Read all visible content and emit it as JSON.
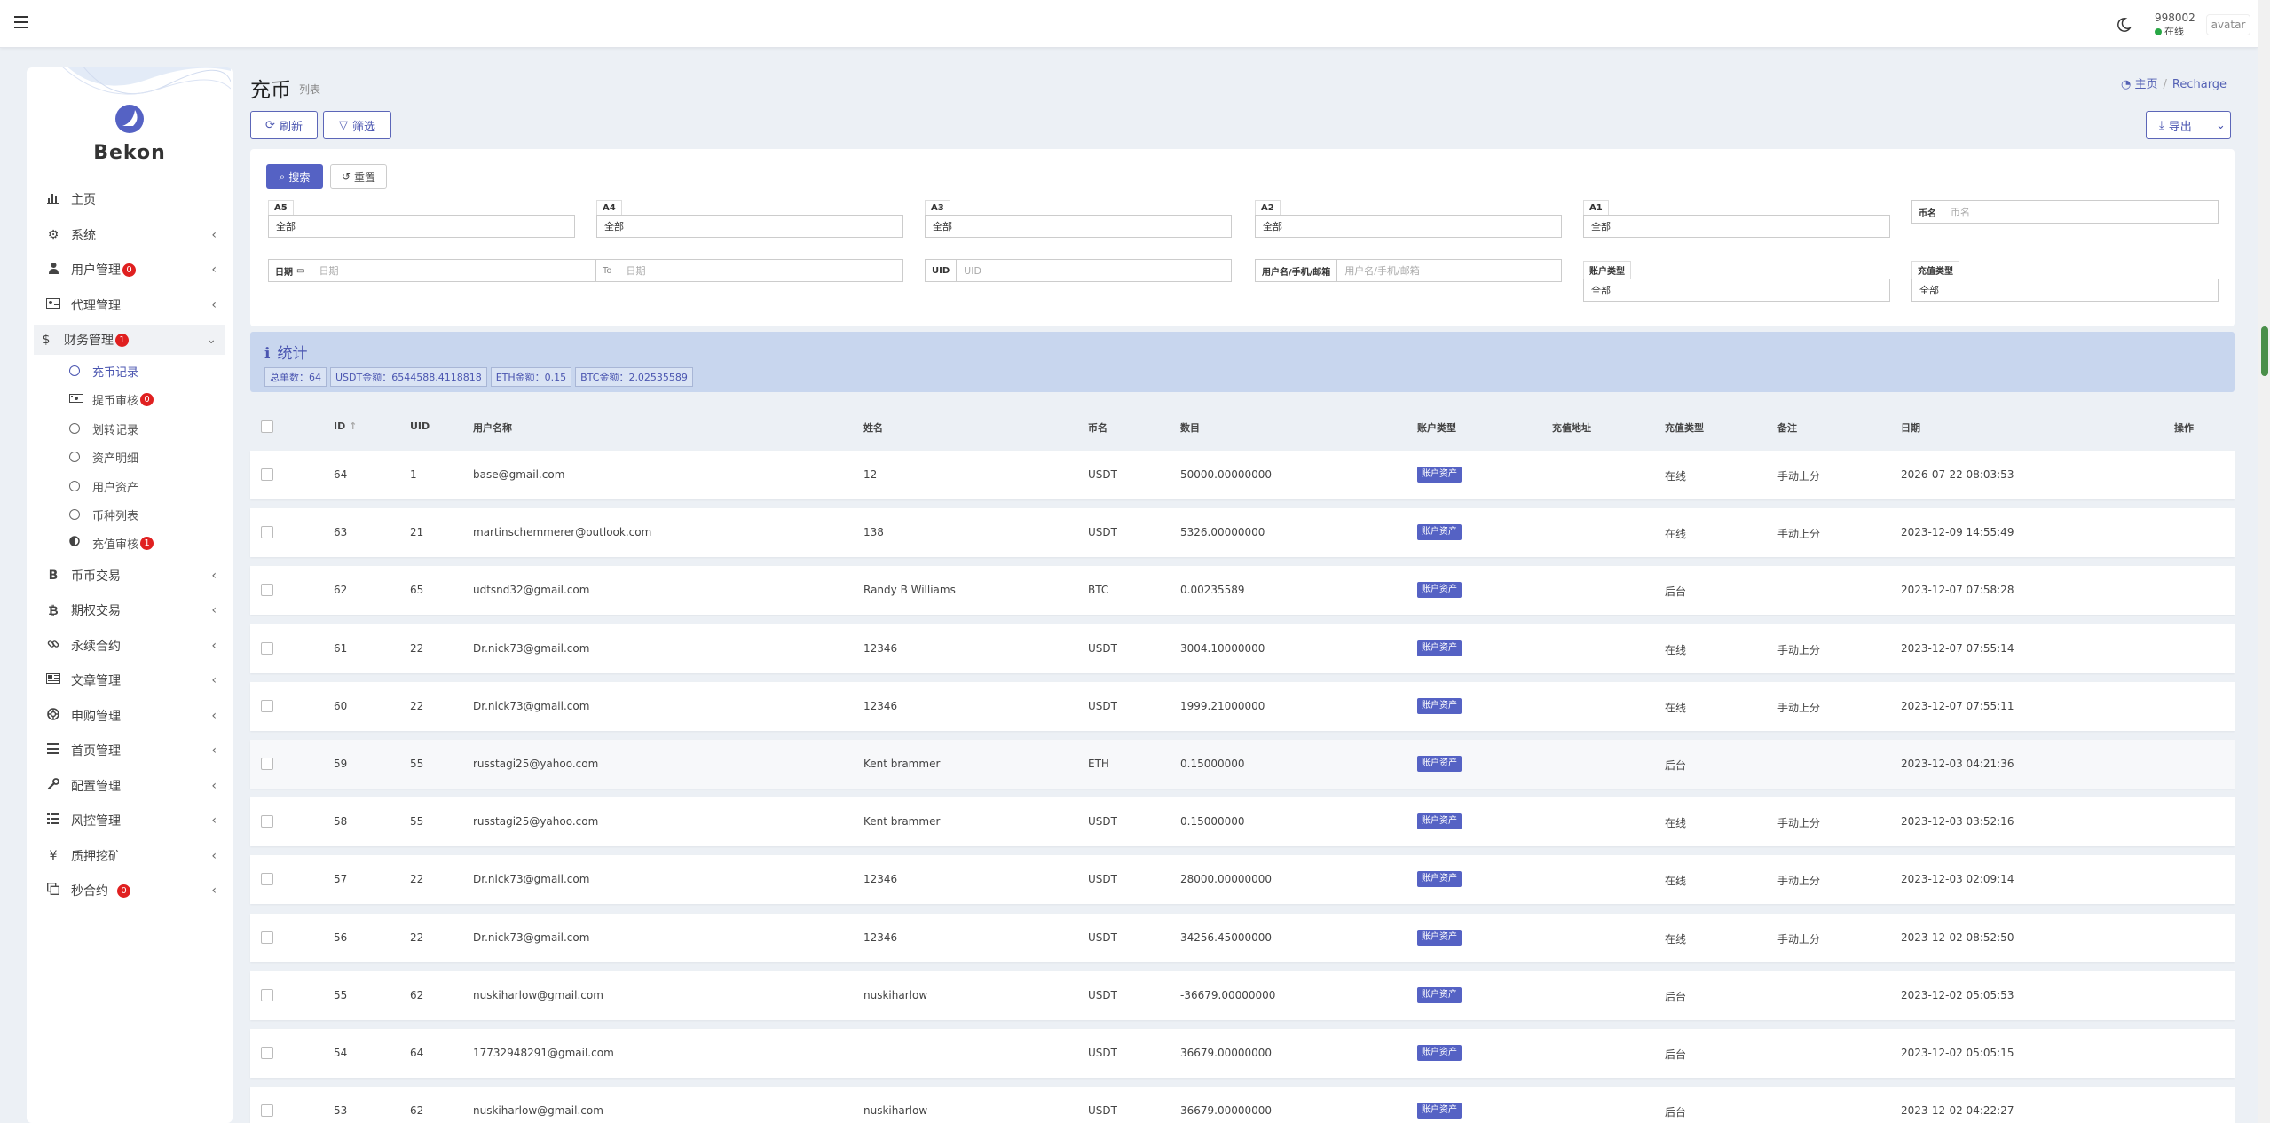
{
  "header": {
    "user_id": "998002",
    "status": "在线",
    "avatar_alt": "avatar"
  },
  "brand": {
    "name": "Bekon"
  },
  "sidebar": {
    "items": [
      {
        "label": "主页",
        "icon": "bar-chart-icon"
      },
      {
        "label": "系统",
        "icon": "gear-icon"
      },
      {
        "label": "用户管理",
        "icon": "user-tie-icon",
        "badge": "0"
      },
      {
        "label": "代理管理",
        "icon": "id-card-icon"
      },
      {
        "label": "财务管理",
        "icon": "dollar-icon",
        "badge": "1"
      },
      {
        "label": "币币交易",
        "icon": "bitcoin-b-icon"
      },
      {
        "label": "期权交易",
        "icon": "bitcoin-icon"
      },
      {
        "label": "永续合约",
        "icon": "link-icon"
      },
      {
        "label": "文章管理",
        "icon": "newspaper-icon"
      },
      {
        "label": "申购管理",
        "icon": "life-ring-icon"
      },
      {
        "label": "首页管理",
        "icon": "list-icon"
      },
      {
        "label": "配置管理",
        "icon": "wrench-icon"
      },
      {
        "label": "风控管理",
        "icon": "list-alt-icon"
      },
      {
        "label": "质押挖矿",
        "icon": "yen-icon"
      },
      {
        "label": "秒合约",
        "icon": "copy-icon",
        "badge": "0"
      }
    ],
    "finance_sub": [
      {
        "label": "充币记录"
      },
      {
        "label": "提币审核",
        "badge": "0"
      },
      {
        "label": "划转记录"
      },
      {
        "label": "资产明细"
      },
      {
        "label": "用户资产"
      },
      {
        "label": "币种列表"
      },
      {
        "label": "充值审核",
        "badge": "1"
      }
    ]
  },
  "page": {
    "title": "充币",
    "subtitle": "列表",
    "breadcrumb_home": "主页",
    "breadcrumb_current": "Recharge"
  },
  "toolbar": {
    "refresh": "刷新",
    "filter": "筛选",
    "export": "导出",
    "search": "搜索",
    "reset": "重置"
  },
  "filters": {
    "a5": {
      "label": "A5",
      "value": "全部"
    },
    "a4": {
      "label": "A4",
      "value": "全部"
    },
    "a3": {
      "label": "A3",
      "value": "全部"
    },
    "a2": {
      "label": "A2",
      "value": "全部"
    },
    "a1": {
      "label": "A1",
      "value": "全部"
    },
    "coin": {
      "label": "币名",
      "placeholder": "币名"
    },
    "date": {
      "label": "日期",
      "placeholder_from": "日期",
      "to": "To",
      "placeholder_to": "日期"
    },
    "uid": {
      "label": "UID",
      "placeholder": "UID"
    },
    "user": {
      "label": "用户名/手机/邮箱",
      "placeholder": "用户名/手机/邮箱"
    },
    "account_type": {
      "label": "账户类型",
      "value": "全部"
    },
    "recharge_type": {
      "label": "充值类型",
      "value": "全部"
    }
  },
  "stats": {
    "title": "统计",
    "total": "总单数：64",
    "usdt": "USDT金额：6544588.4118818",
    "eth": "ETH金额：0.15",
    "btc": "BTC金额：2.02535589"
  },
  "table": {
    "columns": {
      "id": "ID",
      "uid": "UID",
      "username": "用户名称",
      "name": "姓名",
      "coin": "币名",
      "amount": "数目",
      "account_type": "账户类型",
      "address": "充值地址",
      "recharge_type": "充值类型",
      "remark": "备注",
      "date": "日期",
      "action": "操作"
    },
    "rows": [
      {
        "id": "64",
        "uid": "1",
        "username": "base@gmail.com",
        "name": "12",
        "coin": "USDT",
        "amount": "50000.00000000",
        "account_type": "账户资产",
        "recharge_type": "在线",
        "remark": "手动上分",
        "date": "2026-07-22 08:03:53"
      },
      {
        "id": "63",
        "uid": "21",
        "username": "martinschemmerer@outlook.com",
        "name": "138",
        "coin": "USDT",
        "amount": "5326.00000000",
        "account_type": "账户资产",
        "recharge_type": "在线",
        "remark": "手动上分",
        "date": "2023-12-09 14:55:49"
      },
      {
        "id": "62",
        "uid": "65",
        "username": "udtsnd32@gmail.com",
        "name": "Randy B Williams",
        "coin": "BTC",
        "amount": "0.00235589",
        "account_type": "账户资产",
        "recharge_type": "后台",
        "remark": "",
        "date": "2023-12-07 07:58:28"
      },
      {
        "id": "61",
        "uid": "22",
        "username": "Dr.nick73@gmail.com",
        "name": "12346",
        "coin": "USDT",
        "amount": "3004.10000000",
        "account_type": "账户资产",
        "recharge_type": "在线",
        "remark": "手动上分",
        "date": "2023-12-07 07:55:14"
      },
      {
        "id": "60",
        "uid": "22",
        "username": "Dr.nick73@gmail.com",
        "name": "12346",
        "coin": "USDT",
        "amount": "1999.21000000",
        "account_type": "账户资产",
        "recharge_type": "在线",
        "remark": "手动上分",
        "date": "2023-12-07 07:55:11"
      },
      {
        "id": "59",
        "uid": "55",
        "username": "russtagi25@yahoo.com",
        "name": "Kent brammer",
        "coin": "ETH",
        "amount": "0.15000000",
        "account_type": "账户资产",
        "recharge_type": "后台",
        "remark": "",
        "date": "2023-12-03 04:21:36"
      },
      {
        "id": "58",
        "uid": "55",
        "username": "russtagi25@yahoo.com",
        "name": "Kent brammer",
        "coin": "USDT",
        "amount": "0.15000000",
        "account_type": "账户资产",
        "recharge_type": "在线",
        "remark": "手动上分",
        "date": "2023-12-03 03:52:16"
      },
      {
        "id": "57",
        "uid": "22",
        "username": "Dr.nick73@gmail.com",
        "name": "12346",
        "coin": "USDT",
        "amount": "28000.00000000",
        "account_type": "账户资产",
        "recharge_type": "在线",
        "remark": "手动上分",
        "date": "2023-12-03 02:09:14"
      },
      {
        "id": "56",
        "uid": "22",
        "username": "Dr.nick73@gmail.com",
        "name": "12346",
        "coin": "USDT",
        "amount": "34256.45000000",
        "account_type": "账户资产",
        "recharge_type": "在线",
        "remark": "手动上分",
        "date": "2023-12-02 08:52:50"
      },
      {
        "id": "55",
        "uid": "62",
        "username": "nuskiharlow@gmail.com",
        "name": "nuskiharlow",
        "coin": "USDT",
        "amount": "-36679.00000000",
        "account_type": "账户资产",
        "recharge_type": "后台",
        "remark": "",
        "date": "2023-12-02 05:05:53"
      },
      {
        "id": "54",
        "uid": "64",
        "username": "17732948291@gmail.com",
        "name": "",
        "coin": "USDT",
        "amount": "36679.00000000",
        "account_type": "账户资产",
        "recharge_type": "后台",
        "remark": "",
        "date": "2023-12-02 05:05:15"
      },
      {
        "id": "53",
        "uid": "62",
        "username": "nuskiharlow@gmail.com",
        "name": "nuskiharlow",
        "coin": "USDT",
        "amount": "36679.00000000",
        "account_type": "账户资产",
        "recharge_type": "后台",
        "remark": "",
        "date": "2023-12-02 04:22:27"
      }
    ]
  }
}
